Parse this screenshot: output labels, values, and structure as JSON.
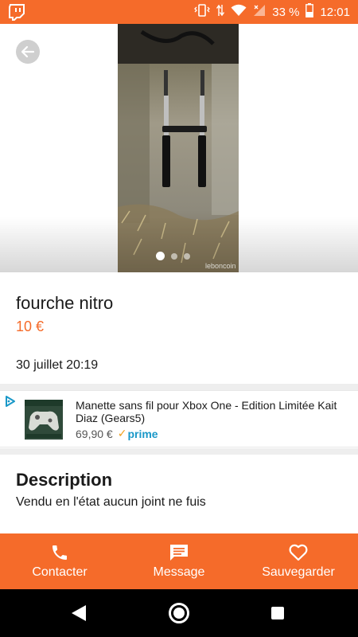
{
  "status_bar": {
    "battery": "33 %",
    "time": "12:01"
  },
  "listing": {
    "title": "fourche nitro",
    "price": "10 €",
    "date": "30 juillet 20:19",
    "image_watermark": "leboncoin",
    "photo_count": 3,
    "active_photo": 1
  },
  "ad": {
    "title": "Manette sans fil pour Xbox One - Edition Limitée Kait Diaz (Gears5)",
    "price": "69,90 €",
    "badge": "prime"
  },
  "description": {
    "heading": "Description",
    "text": "Vendu en l'état aucun joint ne fuis"
  },
  "actions": [
    {
      "label": "Contacter",
      "icon": "phone-icon"
    },
    {
      "label": "Message",
      "icon": "message-icon"
    },
    {
      "label": "Sauvegarder",
      "icon": "heart-icon"
    }
  ],
  "colors": {
    "brand": "#f56b2a",
    "prime_blue": "#1a98c8"
  }
}
